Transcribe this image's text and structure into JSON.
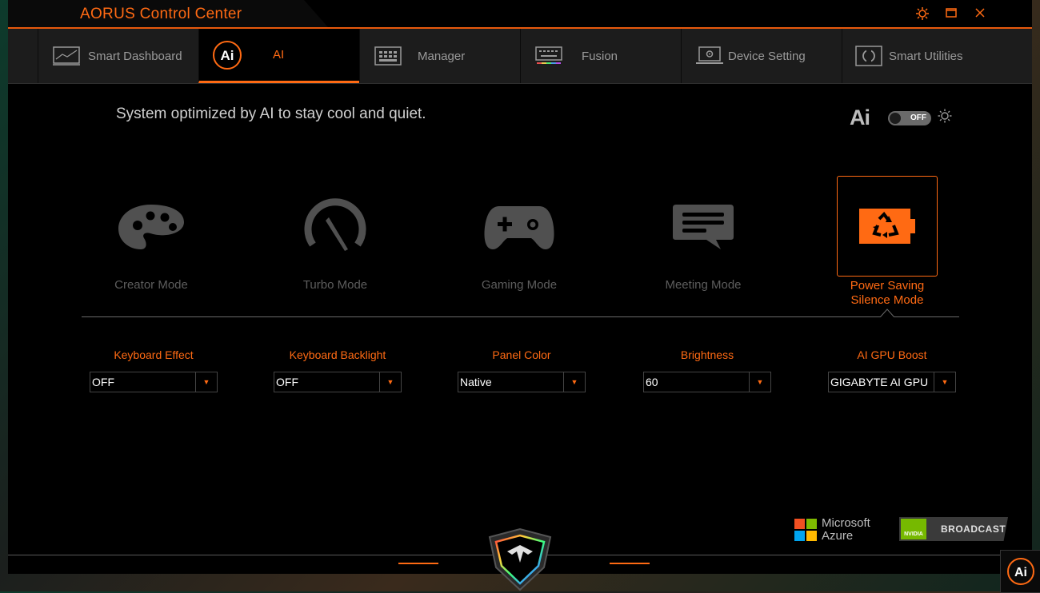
{
  "window": {
    "title": "AORUS Control Center"
  },
  "tabs": [
    {
      "label": "Smart Dashboard",
      "icon": "dashboard-icon",
      "active": false
    },
    {
      "label": "AI",
      "icon": "ai-icon",
      "active": true
    },
    {
      "label": "Manager",
      "icon": "keyboard-grid-icon",
      "active": false
    },
    {
      "label": "Fusion",
      "icon": "rgb-keyboard-icon",
      "active": false
    },
    {
      "label": "Device Setting",
      "icon": "laptop-settings-icon",
      "active": false
    },
    {
      "label": "Smart Utilities",
      "icon": "utilities-icon",
      "active": false
    }
  ],
  "main": {
    "subtitle": "System optimized by AI to stay cool and quiet.",
    "ai_toggle": {
      "logo": "Ai",
      "state": "OFF"
    },
    "modes": [
      {
        "label": "Creator Mode",
        "icon": "palette-icon",
        "active": false
      },
      {
        "label": "Turbo Mode",
        "icon": "speedometer-icon",
        "active": false
      },
      {
        "label": "Gaming Mode",
        "icon": "gamepad-icon",
        "active": false
      },
      {
        "label": "Meeting Mode",
        "icon": "chat-bubble-icon",
        "active": false
      },
      {
        "label_line1": "Power Saving",
        "label_line2": "Silence Mode",
        "icon": "battery-recycle-icon",
        "active": true
      }
    ],
    "settings": [
      {
        "label": "Keyboard Effect",
        "value": "OFF"
      },
      {
        "label": "Keyboard Backlight",
        "value": "OFF"
      },
      {
        "label": "Panel Color",
        "value": "Native"
      },
      {
        "label": "Brightness",
        "value": "60"
      },
      {
        "label": "AI GPU Boost",
        "value": "GIGABYTE AI GPU"
      }
    ]
  },
  "footer": {
    "azure_line1": "Microsoft",
    "azure_line2": "Azure",
    "nvidia_badge": "NVIDIA",
    "nvidia_label": "BROADCAST"
  },
  "colors": {
    "accent": "#ff6a13",
    "inactive": "#5d5d5d",
    "background": "#000000"
  }
}
